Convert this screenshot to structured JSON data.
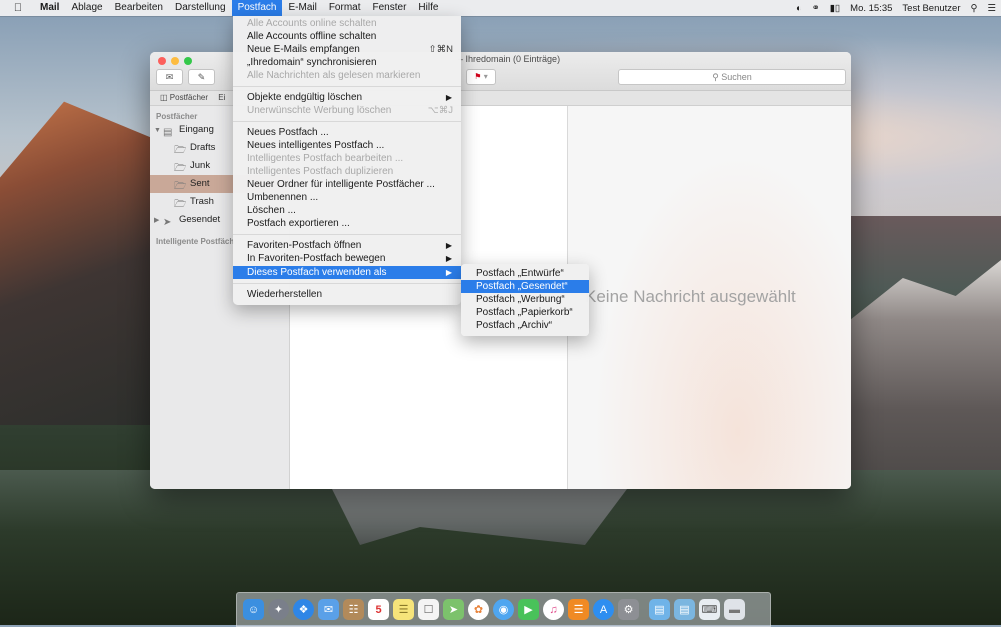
{
  "menubar": {
    "app": "Mail",
    "items": [
      "Ablage",
      "Bearbeiten",
      "Darstellung",
      "Postfach",
      "E-Mail",
      "Format",
      "Fenster",
      "Hilfe"
    ],
    "active": "Postfach",
    "clock": "Mo. 15:35",
    "user": "Test Benutzer"
  },
  "window": {
    "title": "Ihredomain (0 Einträge)",
    "search_placeholder": "Suchen",
    "favorites_label": "Postfächer",
    "favorites_label2": "Ei",
    "sidebar": {
      "header": "Postfächer",
      "items": [
        {
          "label": "Eingang"
        },
        {
          "label": "Drafts"
        },
        {
          "label": "Junk"
        },
        {
          "label": "Sent"
        },
        {
          "label": "Trash"
        },
        {
          "label": "Gesendet"
        }
      ],
      "smart_header": "Intelligente Postfäch"
    },
    "no_message": "Keine Nachricht ausgewählt"
  },
  "menu": {
    "items": [
      {
        "label": "Alle Accounts online schalten",
        "disabled": true
      },
      {
        "label": "Alle Accounts offline schalten"
      },
      {
        "label": "Neue E-Mails empfangen",
        "shortcut": "⇧⌘N"
      },
      {
        "label": "„Ihredomain“ synchronisieren"
      },
      {
        "label": "Alle Nachrichten als gelesen markieren",
        "disabled": true
      },
      {
        "label": "Objekte endgültig löschen"
      },
      {
        "label": "Unerwünschte Werbung löschen",
        "shortcut": "⌥⌘J",
        "disabled": true
      },
      {
        "label": "Neues Postfach ..."
      },
      {
        "label": "Neues intelligentes Postfach ..."
      },
      {
        "label": "Intelligentes Postfach bearbeiten ...",
        "disabled": true
      },
      {
        "label": "Intelligentes Postfach duplizieren",
        "disabled": true
      },
      {
        "label": "Neuer Ordner für intelligente Postfächer ..."
      },
      {
        "label": "Umbenennen ..."
      },
      {
        "label": "Löschen ..."
      },
      {
        "label": "Postfach exportieren ..."
      },
      {
        "label": "Favoriten-Postfach öffnen"
      },
      {
        "label": "In Favoriten-Postfach bewegen"
      },
      {
        "label": "Dieses Postfach verwenden als"
      },
      {
        "label": "Wiederherstellen"
      }
    ]
  },
  "submenu": {
    "items": [
      {
        "label": "Postfach „Entwürfe“"
      },
      {
        "label": "Postfach „Gesendet“"
      },
      {
        "label": "Postfach „Werbung“"
      },
      {
        "label": "Postfach „Papierkorb“"
      },
      {
        "label": "Postfach „Archiv“"
      }
    ],
    "highlighted": "Postfach „Gesendet“"
  },
  "dock": {
    "calendar_day": "5",
    "items": [
      "finder-icon",
      "launchpad-icon",
      "safari-icon",
      "mail-icon",
      "contacts-icon",
      "calendar-icon",
      "notes-icon",
      "reminders-icon",
      "maps-icon",
      "photos-icon",
      "messages-icon",
      "facetime-icon",
      "itunes-icon",
      "ibooks-icon",
      "appstore-icon",
      "system-preferences-icon",
      "folder-icon",
      "downloads-icon",
      "keyboard-icon",
      "trash-icon"
    ]
  }
}
